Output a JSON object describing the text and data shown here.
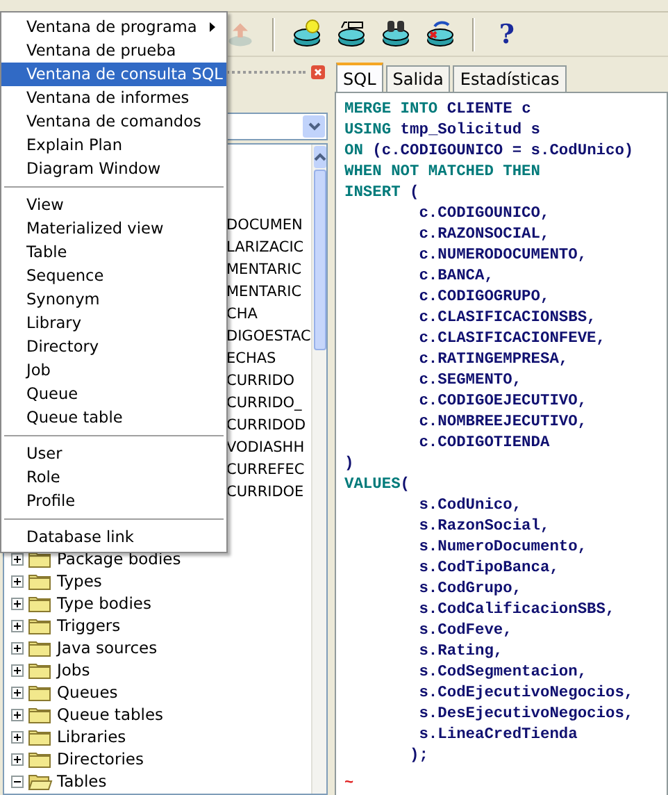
{
  "toolbar": {
    "buttons": [
      {
        "kind": "upload",
        "disabled": true
      },
      {
        "kind": "db-bulb",
        "disabled": false
      },
      {
        "kind": "db-sql",
        "disabled": false
      },
      {
        "kind": "db-binoculars",
        "disabled": false
      },
      {
        "kind": "db-refresh",
        "disabled": false
      },
      {
        "kind": "help",
        "disabled": false,
        "label": "?"
      }
    ]
  },
  "menu": {
    "groups": [
      [
        {
          "label": "Ventana de programa",
          "selected": false,
          "submenu": true
        },
        {
          "label": "Ventana de prueba",
          "selected": false,
          "submenu": false
        },
        {
          "label": "Ventana de consulta SQL",
          "selected": true,
          "submenu": false
        },
        {
          "label": "Ventana de informes",
          "selected": false,
          "submenu": false
        },
        {
          "label": "Ventana de comandos",
          "selected": false,
          "submenu": false
        },
        {
          "label": "Explain Plan",
          "selected": false,
          "submenu": false
        },
        {
          "label": "Diagram Window",
          "selected": false,
          "submenu": false
        }
      ],
      [
        {
          "label": "View",
          "selected": false,
          "submenu": false
        },
        {
          "label": "Materialized view",
          "selected": false,
          "submenu": false
        },
        {
          "label": "Table",
          "selected": false,
          "submenu": false
        },
        {
          "label": "Sequence",
          "selected": false,
          "submenu": false
        },
        {
          "label": "Synonym",
          "selected": false,
          "submenu": false
        },
        {
          "label": "Library",
          "selected": false,
          "submenu": false
        },
        {
          "label": "Directory",
          "selected": false,
          "submenu": false
        },
        {
          "label": "Job",
          "selected": false,
          "submenu": false
        },
        {
          "label": "Queue",
          "selected": false,
          "submenu": false
        },
        {
          "label": "Queue table",
          "selected": false,
          "submenu": false
        }
      ],
      [
        {
          "label": "User",
          "selected": false,
          "submenu": false
        },
        {
          "label": "Role",
          "selected": false,
          "submenu": false
        },
        {
          "label": "Profile",
          "selected": false,
          "submenu": false
        }
      ],
      [
        {
          "label": "Database link",
          "selected": false,
          "submenu": false
        }
      ]
    ]
  },
  "browser": {
    "covered_fragments": [
      "DOCUMEN",
      "LARIZACIC",
      "MENTARIC",
      "MENTARIC",
      "CHA",
      "DIGOESTAC",
      "ECHAS",
      "CURRIDO",
      "CURRIDO_",
      "CURRIDOD",
      "VODIASHH",
      "CURREFEC",
      "CURRIDOE"
    ],
    "tree": [
      {
        "label": "Package bodies",
        "expanded": false
      },
      {
        "label": "Types",
        "expanded": false
      },
      {
        "label": "Type bodies",
        "expanded": false
      },
      {
        "label": "Triggers",
        "expanded": false
      },
      {
        "label": "Java sources",
        "expanded": false
      },
      {
        "label": "Jobs",
        "expanded": false
      },
      {
        "label": "Queues",
        "expanded": false
      },
      {
        "label": "Queue tables",
        "expanded": false
      },
      {
        "label": "Libraries",
        "expanded": false
      },
      {
        "label": "Directories",
        "expanded": false
      },
      {
        "label": "Tables",
        "expanded": true
      }
    ]
  },
  "tabs": [
    {
      "label": "SQL",
      "selected": true
    },
    {
      "label": "Salida",
      "selected": false
    },
    {
      "label": "Estadísticas",
      "selected": false
    }
  ],
  "editor": {
    "lines": [
      [
        {
          "text": "MERGE INTO ",
          "kind": "keyword"
        },
        {
          "text": "CLIENTE c",
          "kind": "ident"
        }
      ],
      [
        {
          "text": "USING ",
          "kind": "keyword"
        },
        {
          "text": "tmp_Solicitud s",
          "kind": "ident"
        }
      ],
      [
        {
          "text": "ON ",
          "kind": "keyword"
        },
        {
          "text": "(c.CODIGOUNICO = s.CodUnico)",
          "kind": "ident"
        }
      ],
      [
        {
          "text": "WHEN NOT MATCHED THEN",
          "kind": "keyword"
        }
      ],
      [
        {
          "text": "INSERT ",
          "kind": "keyword"
        },
        {
          "text": "(",
          "kind": "ident"
        }
      ],
      [
        {
          "text": "        c.CODIGOUNICO,",
          "kind": "ident"
        }
      ],
      [
        {
          "text": "        c.RAZONSOCIAL,",
          "kind": "ident"
        }
      ],
      [
        {
          "text": "        c.NUMERODOCUMENTO,",
          "kind": "ident"
        }
      ],
      [
        {
          "text": "        c.BANCA,",
          "kind": "ident"
        }
      ],
      [
        {
          "text": "        c.CODIGOGRUPO,",
          "kind": "ident"
        }
      ],
      [
        {
          "text": "        c.CLASIFICACIONSBS,",
          "kind": "ident"
        }
      ],
      [
        {
          "text": "        c.CLASIFICACIONFEVE,",
          "kind": "ident"
        }
      ],
      [
        {
          "text": "        c.RATINGEMPRESA,",
          "kind": "ident"
        }
      ],
      [
        {
          "text": "        c.SEGMENTO,",
          "kind": "ident"
        }
      ],
      [
        {
          "text": "        c.CODIGOEJECUTIVO,",
          "kind": "ident"
        }
      ],
      [
        {
          "text": "        c.NOMBREEJECUTIVO,",
          "kind": "ident"
        }
      ],
      [
        {
          "text": "        c.CODIGOTIENDA",
          "kind": "ident"
        }
      ],
      [
        {
          "text": ")",
          "kind": "ident"
        }
      ],
      [
        {
          "text": "VALUES",
          "kind": "keyword"
        },
        {
          "text": "(",
          "kind": "ident"
        }
      ],
      [
        {
          "text": "        s.CodUnico,",
          "kind": "ident"
        }
      ],
      [
        {
          "text": "        s.RazonSocial,",
          "kind": "ident"
        }
      ],
      [
        {
          "text": "        s.NumeroDocumento,",
          "kind": "ident"
        }
      ],
      [
        {
          "text": "        s.CodTipoBanca,",
          "kind": "ident"
        }
      ],
      [
        {
          "text": "        s.CodGrupo,",
          "kind": "ident"
        }
      ],
      [
        {
          "text": "        s.CodCalificacionSBS,",
          "kind": "ident"
        }
      ],
      [
        {
          "text": "        s.CodFeve,",
          "kind": "ident"
        }
      ],
      [
        {
          "text": "        s.Rating,",
          "kind": "ident"
        }
      ],
      [
        {
          "text": "        s.CodSegmentacion,",
          "kind": "ident"
        }
      ],
      [
        {
          "text": "        s.CodEjecutivoNegocios,",
          "kind": "ident"
        }
      ],
      [
        {
          "text": "        s.DesEjecutivoNegocios,",
          "kind": "ident"
        }
      ],
      [
        {
          "text": "        s.LineaCredTienda",
          "kind": "ident"
        }
      ],
      [
        {
          "text": "       );",
          "kind": "ident"
        }
      ]
    ],
    "end_marker": "~"
  }
}
